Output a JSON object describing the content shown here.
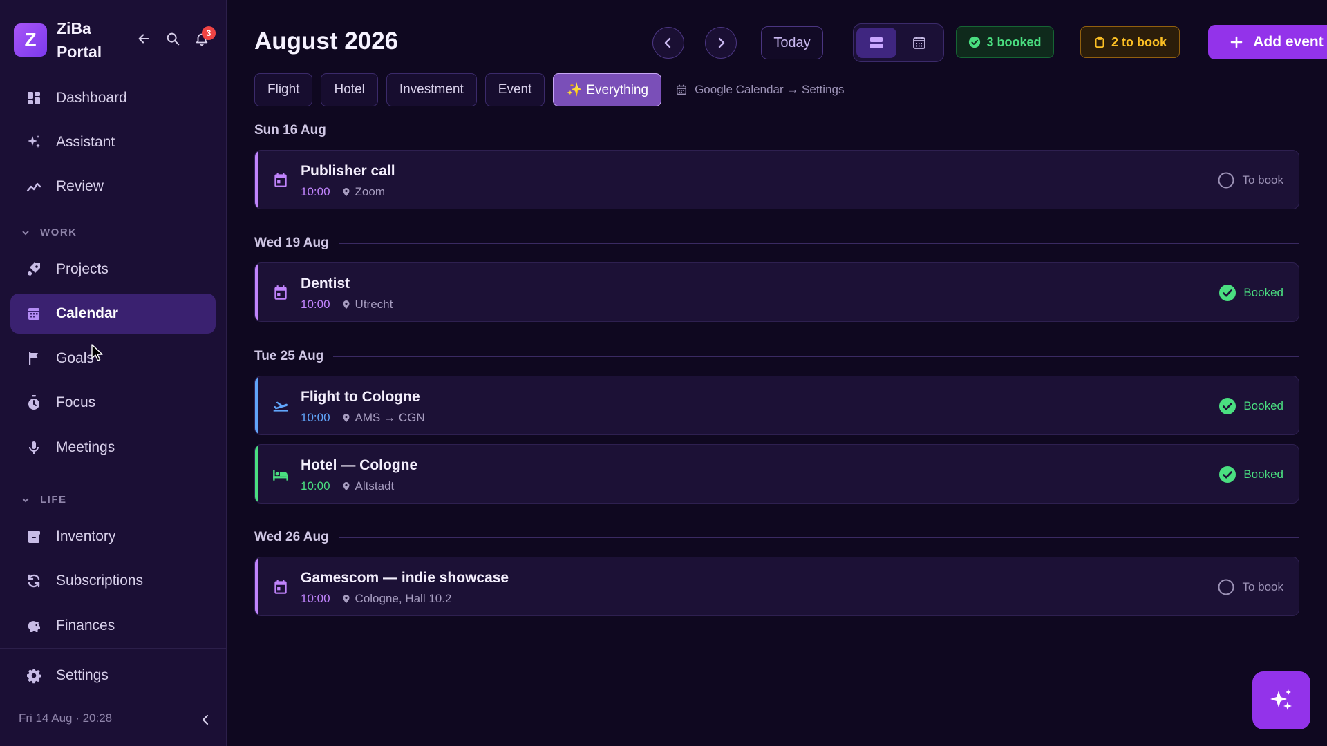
{
  "sidebar": {
    "brand_initial": "Z",
    "brand_name": "ZiBa Portal",
    "notification_count": "3",
    "nav_top": [
      {
        "label": "Dashboard",
        "icon": "dashboard-icon"
      },
      {
        "label": "Assistant",
        "icon": "sparkle-icon"
      },
      {
        "label": "Review",
        "icon": "trend-icon"
      }
    ],
    "section_work": "WORK",
    "nav_work": [
      {
        "label": "Projects",
        "icon": "rocket-icon"
      },
      {
        "label": "Calendar",
        "icon": "calendar-icon",
        "active": true
      },
      {
        "label": "Goals",
        "icon": "flag-icon"
      },
      {
        "label": "Focus",
        "icon": "timer-icon"
      },
      {
        "label": "Meetings",
        "icon": "mic-icon"
      }
    ],
    "section_life": "LIFE",
    "nav_life": [
      {
        "label": "Inventory",
        "icon": "archive-icon"
      },
      {
        "label": "Subscriptions",
        "icon": "refresh-icon"
      },
      {
        "label": "Finances",
        "icon": "piggy-bank-icon"
      }
    ],
    "settings_label": "Settings",
    "footer_datetime": "Fri 14 Aug · 20:28"
  },
  "header": {
    "month_title": "August 2026",
    "today_label": "Today",
    "booked_count": "3 booked",
    "to_book_count": "2 to book",
    "add_event_label": "Add event"
  },
  "filters": {
    "items": [
      "Flight",
      "Hotel",
      "Investment",
      "Event",
      "✨ Everything"
    ],
    "active": "✨ Everything",
    "gcal_link": "Google Calendar → Settings"
  },
  "days": [
    {
      "label": "Sun 16 Aug"
    },
    {
      "label": "Wed 19 Aug"
    },
    {
      "label": "Tue 25 Aug"
    },
    {
      "label": "Wed 26 Aug"
    }
  ],
  "events": [
    {
      "title": "Publisher call",
      "time": "10:00",
      "location": "Zoom",
      "status": "To book",
      "type": "event"
    },
    {
      "title": "Dentist",
      "time": "10:00",
      "location": "Utrecht",
      "status": "Booked",
      "type": "event"
    },
    {
      "title": "Flight to Cologne",
      "time": "10:00",
      "location": "AMS → CGN",
      "status": "Booked",
      "type": "flight"
    },
    {
      "title": "Hotel — Cologne",
      "time": "10:00",
      "location": "Altstadt",
      "status": "Booked",
      "type": "hotel"
    },
    {
      "title": "Gamescom — indie showcase",
      "time": "10:00",
      "location": "Cologne, Hall 10.2",
      "status": "To book",
      "type": "event"
    }
  ],
  "colors": {
    "accent": "#9333ea",
    "event": "#c084fc",
    "flight": "#60a5fa",
    "hotel": "#4ade80",
    "booked": "#4ade80",
    "to_book": "#fbbf24"
  }
}
